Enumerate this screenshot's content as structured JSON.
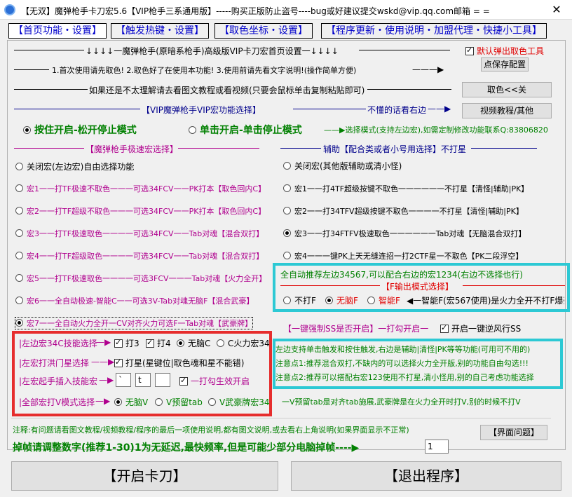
{
  "window": {
    "title": "【无双】魔弹枪手卡刀宏5.6【VIP枪手三系通用版】-----购买正版防止盗号----bug或好建议提交wskd@vip.qq.com邮箱 = ="
  },
  "tabs": [
    "【首页功能・设置】",
    "【触发热键・设置】",
    "【取色坐标・设置】",
    "【程序更新・使用说明・加盟代理・快捷小工具】"
  ],
  "header": {
    "title_line": "↓↓↓↓一魔弹枪手(原暗系枪手)高级版VIP卡刀宏首页设置一↓↓↓↓",
    "steps": "1.首次使用请先取色!  2.取色好了在使用本功能!   3.使用前请先看文字说明!(操作简单方便)",
    "tutorial": "如果还是不太理解请去看图文教程或看视频(只要会鼠标单击复制粘贴即可)",
    "vip_select": "【VIP魔弹枪手VIP宏功能选择】",
    "vip_hint": "不懂的话看右边",
    "popup_label": "默认弹出取色工具",
    "save_btn": "点保存配置",
    "pick_btn": "取色<<关",
    "video_btn": "视频教程/其他"
  },
  "mode": {
    "opt1": "按住开启-松开停止模式",
    "opt2": "单击开启-单击停止模式",
    "desc": "选择模式(支持左边宏),如需定制修改功能联系Q:83806820"
  },
  "left": {
    "title": "【魔弹枪手极速宏选择】",
    "items": [
      "关闭宏(左边宏)自由选择功能",
      "宏1一一打TF极速不取色一一一可选34FCV一一PK打本【取色回内C】",
      "宏2一一打TF超级不取色一一一可选34FCV一一PK打本【取色回内C】",
      "宏3一一打TF极速取色一一一一可选34FCV一一Tab对魂【混合双打】",
      "宏4一一打TF超级取色一一一一可选34FCV一一Tab对魂【混合双打】",
      "宏5一一打TF极速取色一一一一可选3FCV一一一Tab对魂【火力全开】",
      "宏6一一全自动极速-智能C一一可选3V-Tab对魂无脑F【混合武豪】",
      "宏7一一全自动火力全开一CV对齐火力可选F一Tab对魂【武豪牌】"
    ]
  },
  "right": {
    "title": "辅助【配合类或者小号用选择】不打星",
    "items": [
      "关闭宏(其他版辅助或清小怪)",
      "宏1一一打4TF超级按键不取色一一一一一一不打星【清怪|辅助|PK】",
      "宏2一一打34TFV超级按键不取色一一一一不打星【清怪|辅助|PK】",
      "宏3一一打34FTFV极速取色一一一一一一Tab对魂【无脑混合双打】",
      "宏4一一一键PK上天无缝连招一打2CTF星一不取色【PK二段浮空】"
    ]
  },
  "cyan_box1": {
    "line1": "全自动推荐左边34567,可以配合右边的宏1234(右边不选择也行)",
    "f_title": "【F输出模式选择】",
    "f_opts": [
      "不打F",
      "无脑F",
      "智能F"
    ],
    "f_desc": "一智能F(宏567使用)是火力全开不打F爆豪"
  },
  "bottom_left": {
    "row1_label": "|左边宏34C技能选择",
    "row1_opts": [
      "打3",
      "打4",
      "无脑C",
      "C火力宏345"
    ],
    "row2_label": "|左宏打洪门星选择",
    "row2_opt": "打星(星键位|取色魂和星不能错)",
    "row3_label": "|左宏起手插入技能宏",
    "row3_inputs": [
      "`",
      "t",
      ""
    ],
    "row3_opt": "一打勾生效开启",
    "row4_label": "|全部宏打V模式选择",
    "row4_opts": [
      "无脑V",
      "V预留tab",
      "V武豪牌宏345"
    ]
  },
  "row7_right": {
    "text": "【一键强制SS是否开启】一打勾开启一",
    "opt": "开启一键逆风行SS"
  },
  "cyan_box2": {
    "line1": "左边支持单击触发和按住触发,右边是辅助|清怪|PK等等功能(可用可不用的)",
    "line2": "注意点1:推荐混合双打,不缺内的可以选择火力全开版,别的功能自由勾选!!!",
    "line3": "注意点2:推荐可以搭配右宏123使用不打星,清小怪用,别的自己考虑功能选择"
  },
  "vnote": "一V预留tab是对齐tab施展,武豪牌是在火力全开时打V,别的时候不打V",
  "footer": {
    "note": "注释:有问题请看图文教程/视频教程/程序的最后一项使用说明,都有图文说明,或去看右上角说明(如果界面显示不正常)",
    "ui_btn": "【界面问题】",
    "frame_label": "掉帧请调整数字(推荐1-30)1为无延迟,最快频率,但是可能少部分电脑掉帧----▶",
    "frame_value": "1"
  },
  "actions": {
    "start": "【开启卡刀】",
    "exit": "【退出程序】"
  },
  "colors": {
    "cyan": "#2dc9d4",
    "red": "#e62d2d",
    "green": "#008000",
    "blue": "#00008b",
    "magenta": "#b0008e"
  }
}
